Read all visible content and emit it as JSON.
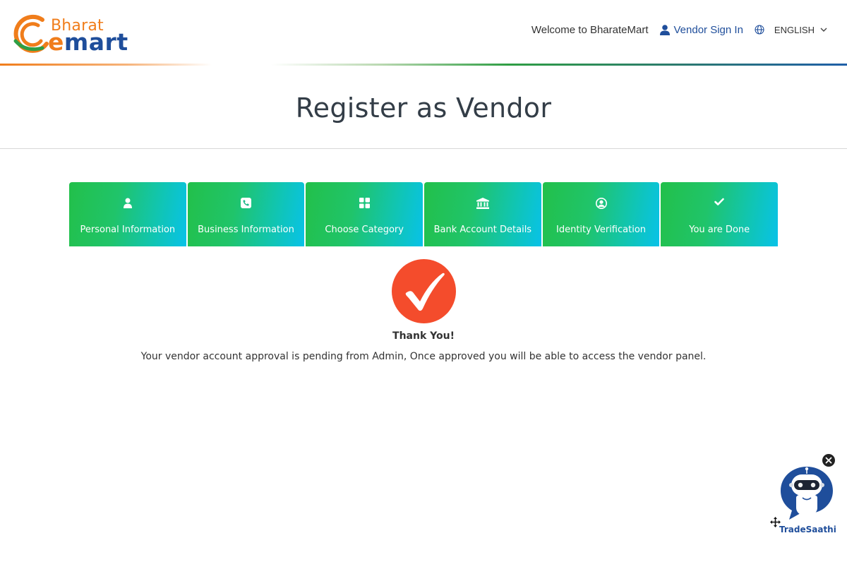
{
  "header": {
    "logo_line1": "Bharat",
    "logo_line2_accent": "e",
    "logo_line2": "mart",
    "welcome": "Welcome to BharateMart",
    "signin": "Vendor Sign In",
    "language": "ENGLISH"
  },
  "page": {
    "title": "Register as Vendor"
  },
  "steps": [
    {
      "label": "Personal Information",
      "icon": "user-icon"
    },
    {
      "label": "Business Information",
      "icon": "phone-icon"
    },
    {
      "label": "Choose Category",
      "icon": "grid-icon"
    },
    {
      "label": "Bank Account Details",
      "icon": "bank-icon"
    },
    {
      "label": "Identity Verification",
      "icon": "user-circle-icon"
    },
    {
      "label": "You are Done",
      "icon": "check-icon"
    }
  ],
  "success": {
    "heading": "Thank You!",
    "message": "Your vendor account approval is pending from Admin, Once approved you will be able to access the vendor panel."
  },
  "chatbot": {
    "name": "TradeSaathi"
  },
  "colors": {
    "brand_blue": "#1f4e9b",
    "brand_orange": "#f07d1b",
    "step_start": "#22c04a",
    "step_end": "#08c2e8",
    "success_red": "#f44c2c"
  }
}
